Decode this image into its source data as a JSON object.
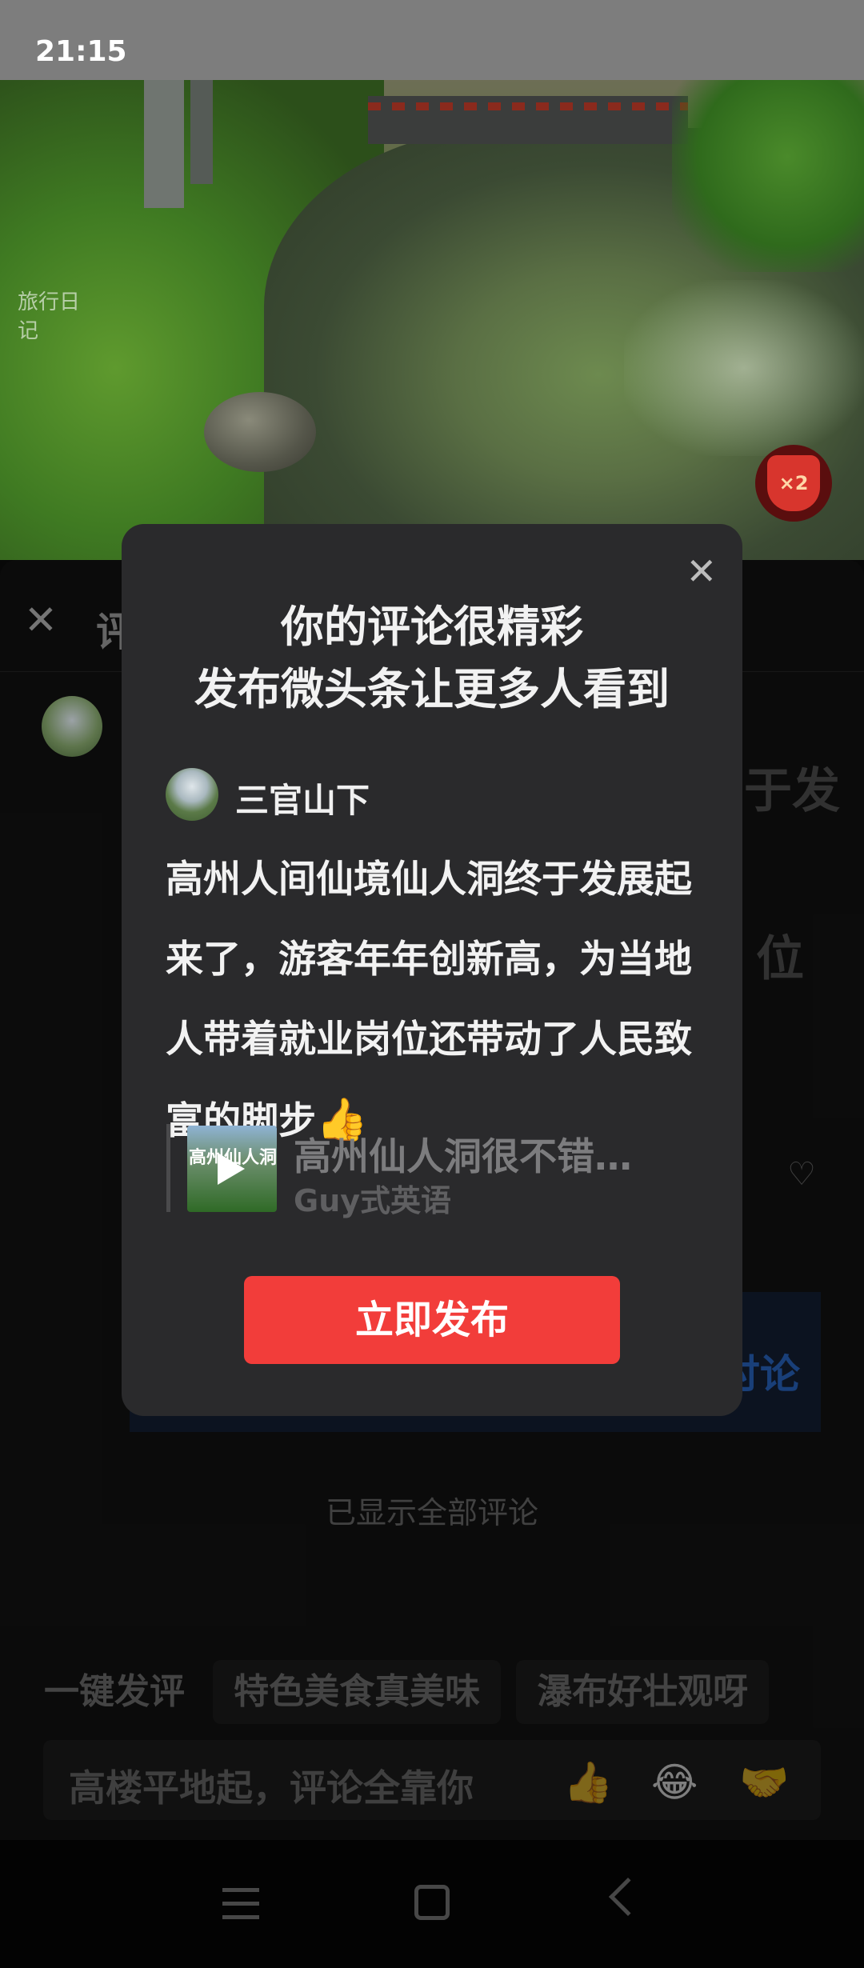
{
  "status_bar": {
    "time": "21:15"
  },
  "video": {
    "watermark": "旅行日记",
    "bonus_badge": "×2"
  },
  "comment_panel": {
    "title_partial": "评",
    "bg_text_right_1": "于发",
    "bg_text_right_2": "位",
    "bg_button_partial": "讨论",
    "all_comments_shown": "已显示全部评论",
    "quick_comments": [
      "一键发评",
      "特色美食真美味",
      "瀑布好壮观呀"
    ],
    "input_placeholder": "高楼平地起，评论全靠你",
    "input_emojis": [
      "👍",
      "😂",
      "🤝"
    ]
  },
  "modal": {
    "title_line1": "你的评论很精彩",
    "title_line2": "发布微头条让更多人看到",
    "user_name": "三官山下",
    "comment_text": "高州人间仙境仙人洞终于发展起来了，游客年年创新高，为当地人带着就业岗位还带动了人民致富的脚步",
    "comment_emoji": "👍",
    "reference": {
      "thumb_text": "高州仙人洞",
      "title": "高州仙人洞很不错…",
      "author": "Guy式英语"
    },
    "publish_button": "立即发布"
  },
  "icons": {
    "close": "close-icon",
    "play": "play-icon",
    "heart": "broken-heart-icon"
  }
}
